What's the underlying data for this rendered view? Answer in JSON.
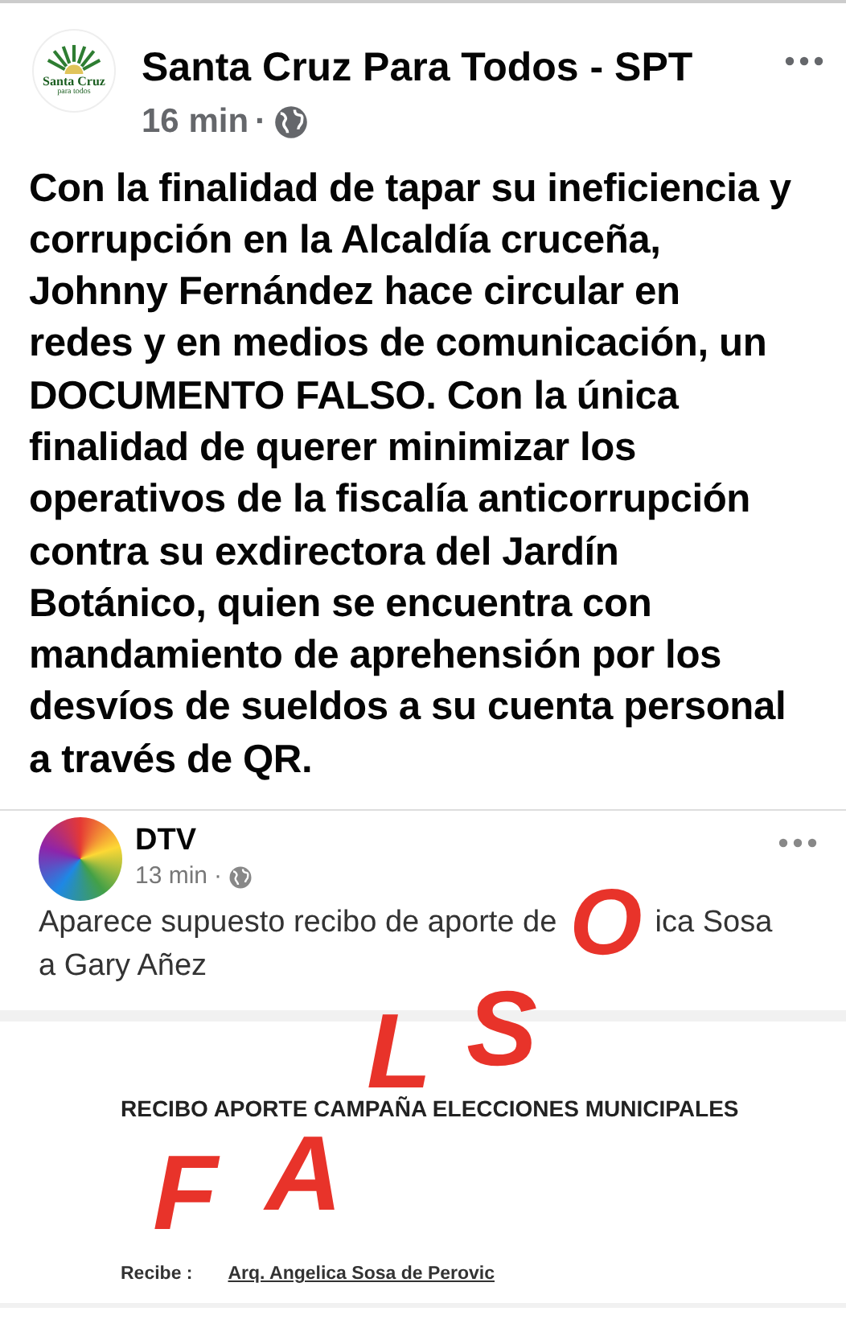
{
  "post": {
    "page_name": "Santa Cruz Para Todos - SPT",
    "time": "16 min",
    "separator": "·",
    "logo_text": [
      "Santa Cruz",
      "para todos"
    ],
    "text": "Con la finalidad de tapar su ineficiencia y\ncorrupción en la Alcaldía cruceña,\nJohnny Fernández hace circular en\nredes y en medios de comunicación, un\nDOCUMENTO FALSO. Con la única\nfinalidad de querer minimizar los\noperativos de la fiscalía anticorrupción\ncontra su exdirectora del Jardín\nBotánico, quien se encuentra con\nmandamiento de aprehensión por los\ndesvíos de sueldos a su cuenta personal\na través de QR."
  },
  "shared_image": {
    "page_name": "DTV",
    "time": "13 min",
    "separator": "·",
    "text_parts": [
      "Aparece supuesto recibo de aporte de",
      "ica Sosa",
      "a Gary Añez"
    ],
    "document": {
      "heading": "RECIBO APORTE CAMPAÑA ELECCIONES MUNICIPALES",
      "label": "Recibe :",
      "recipient": "Arq. Angelica Sosa de Perovic"
    },
    "stamp_letters": [
      "F",
      "A",
      "L",
      "S",
      "O"
    ]
  }
}
